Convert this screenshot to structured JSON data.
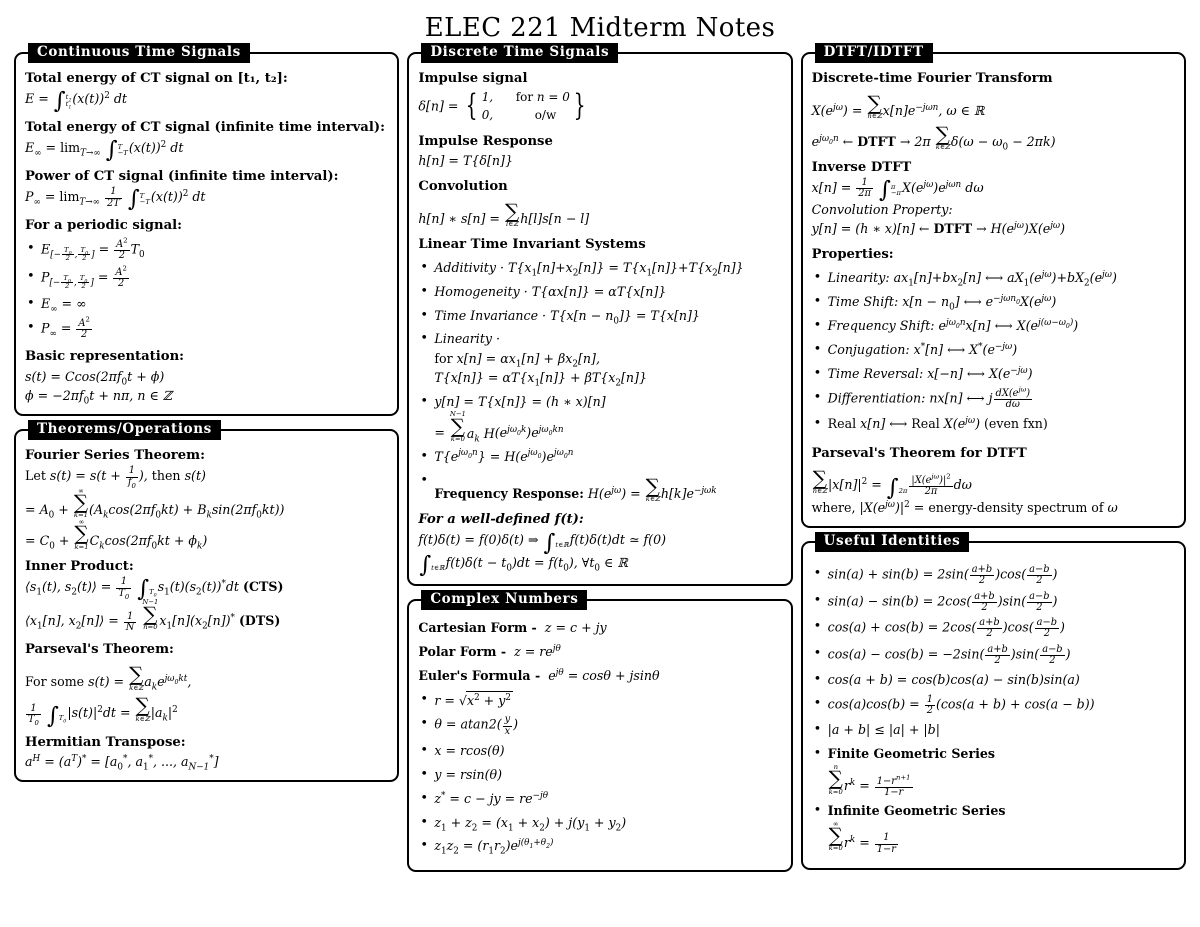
{
  "title": "ELEC 221 Midterm Notes",
  "boxes": {
    "ct": {
      "title": "Continuous Time Signals",
      "h_total_energy": "Total energy of CT signal on [t₁, t₂]:",
      "h_total_energy_inf": "Total energy of CT signal (infinite time interval):",
      "h_power_inf": "Power of CT signal (infinite time interval):",
      "h_periodic": "For a periodic signal:",
      "h_basic": "Basic representation:",
      "eq_energy": "E = ∫_{t₁}^{t₂} (x(t))² dt",
      "eq_energy_inf": "E∞ = lim_{T→∞} ∫_{-T}^{T} (x(t))² dt",
      "eq_power_inf": "P∞ = lim_{T→∞} (1/2T) ∫_{-T}^{T} (x(t))² dt",
      "bullets": [
        "E|-T₀/2, T₀/2| = (A²/2) T₀",
        "P|-T₀/2, T₀/2| = A²/2",
        "E∞ = ∞",
        "P∞ = A²/2"
      ],
      "eq_basic_1": "s(t) = C cos(2πf₀t + ϕ)",
      "eq_basic_2": "ϕ = -2πf₀t + nπ, n ∈ ℤ"
    },
    "theorems": {
      "title": "Theorems/Operations",
      "h_fourier": "Fourier Series Theorem:",
      "fs_line1": "Let s(t) = s(t + 1/f₀), then s(t)",
      "fs_line2": "= A₀ + ∑_{k=1}^{∞} (A_k cos(2πf₀kt) + B_k sin(2πf₀kt))",
      "fs_line3": "= C₀ + ∑_{k=1}^{∞} C_k cos(2πf₀kt + ϕ_k)",
      "h_inner": "Inner Product:",
      "ip_cts": "⟨s₁(t), s₂(t)⟩ = (1/T₀) ∫_{T₀} s₁(t)(s₂(t))* dt (CTS)",
      "ip_dts": "⟨x₁[n], x₂[n]⟩ = (1/N) ∑_{n=0}^{N-1} x₁[n](x₂[n])* (DTS)",
      "h_parseval": "Parseval's Theorem:",
      "pv_line1": "For some s(t) = ∑_{k∈ℤ} a_k e^{jω₀kt},",
      "pv_line2": "(1/T₀) ∫_{T₀} |s(t)|²dt = ∑_{k∈ℤ} |a_k|²",
      "h_hermitian": "Hermitian Transpose:",
      "herm": "a^H = (a^T)* = [a₀*, a₁*, ..., a_{N-1}*]"
    },
    "dt": {
      "title": "Discrete Time Signals",
      "h_impulse": "Impulse signal",
      "impulse_case1_val": "1,",
      "impulse_case1_cond": "for n = 0",
      "impulse_case2_val": "0,",
      "impulse_case2_cond": "o/w",
      "h_impulse_response": "Impulse Response",
      "eq_impulse_response": "h[n] = T{δ[n]}",
      "h_convolution": "Convolution",
      "eq_convolution": "h[n] * s[n] = ∑_{l∈ℤ} h[l]s[n - l]",
      "h_lti": "Linear Time Invariant Systems",
      "lti": [
        "Additivity · T{x₁[n]+x₂[n]} = T{x₁[n]}+T{x₂[n]}",
        "Homogeneity · T{αx[n]} = αT{x[n]}",
        "Time Invariance · T{x[n - n₀]} = T{x[n]}",
        "Linearity ·",
        "y[n] = T{x[n]} = (h * x)[n]",
        "T{e^{jω₀n}} = H(e^{jω₀})e^{jω₀n}",
        "Frequency Response: H(e^{jω}) = ∑_{k∈ℤ} h[k]e^{-jωk}"
      ],
      "lin_sub1": "for x[n] = αx₁[n] + βx₂[n],",
      "lin_sub2": "T{x[n]} = αT{x₁[n]} + βT{x₂[n]}",
      "y_sub": "= ∑_{k=0}^{N-1} a_k H(e^{jω₀k})e^{jω₀kn}",
      "h_welldefined": "For a well-defined f(t):",
      "wd_line1": "f(t)δ(t) = f(0)δ(t) ⇒ ∫_{t∈ℝ} f(t)δ(t)dt ≃ f(0)",
      "wd_line2": "∫_{t∈ℝ} f(t)δ(t - t₀)dt = f(t₀), ∀t₀ ∈ ℝ"
    },
    "complex": {
      "title": "Complex Numbers",
      "h_cartesian": "Cartesian Form -",
      "eq_cartesian": "z = c + jy",
      "h_polar": "Polar Form -",
      "eq_polar": "z = re^{jθ}",
      "h_euler": "Euler's Formula -",
      "eq_euler": "e^{jθ} = cosθ + jsinθ",
      "bullets": [
        "r = √(x² + y²)",
        "θ = atan2(y/x)",
        "x = rcos(θ)",
        "y = rsin(θ)",
        "z* = c - jy = re^{-jθ}",
        "z₁ + z₂ = (x₁ + x₂) + j(y₁ + y₂)",
        "z₁z₂ = (r₁r₂)e^{j(θ₁+θ₂)}"
      ]
    },
    "dtft": {
      "title": "DTFT/IDTFT",
      "h_dtft": "Discrete-time Fourier Transform",
      "dtft_line1": "X(e^{jω}) = ∑_{n∈ℤ} x[n]e^{-jωn}, ω ∈ ℝ",
      "dtft_line2": "e^{jω₀n} ← DTFT → 2π ∑_{k∈ℤ} δ(ω - ω₀ - 2πk)",
      "h_idtft": "Inverse DTFT",
      "idtft_line1": "x[n] = (1/2π) ∫_{-π}^{π} X(e^{jω})e^{jωn} dω",
      "h_convprop": "Convolution Property:",
      "convprop": "y[n] = (h * x)[n] ← DTFT → H(e^{jω})X(e^{jω})",
      "h_properties": "Properties:",
      "properties": [
        "Linearity: ax₁[n]+bx₂[n] ⟷ aX₁(e^{jω})+bX₂(e^{jω})",
        "Time Shift: x[n - n₀] ⟷ e^{-jωn₀}X(e^{jω})",
        "Frequency Shift: e^{jω₀n}x[n] ⟷ X(e^{j(ω-ω₀)})",
        "Conjugation: x*[n] ⟷ X*(e^{-jω})",
        "Time Reversal: x[-n] ⟷ X(e^{-jω})",
        "Differentiation: nx[n] ⟷ j dX(e^{jω})/dω",
        "Real x[n] ⟷ Real X(e^{jω}) (even fxn)"
      ],
      "h_parseval": "Parseval's Theorem for DTFT",
      "pv_line1": "∑_{n∈ℤ} |x[n]|² = ∫_{2π} |X(e^{jω})|²/2π dω",
      "pv_line2": "where, |X(e^{jω})|² = energy-density spectrum of ω"
    },
    "identities": {
      "title": "Useful Identities",
      "bullets": [
        "sin(a) + sin(b) = 2sin((a+b)/2)cos((a-b)/2)",
        "sin(a) - sin(b) = 2cos((a+b)/2)sin((a-b)/2)",
        "cos(a) + cos(b) = 2cos((a+b)/2)cos((a-b)/2)",
        "cos(a) - cos(b) = -2sin((a+b)/2)sin((a-b)/2)",
        "cos(a + b) = cos(b)cos(a) - sin(b)sin(a)",
        "cos(a)cos(b) = ½(cos(a + b) + cos(a - b))",
        "|a + b| ≤ |a| + |b|"
      ],
      "h_finite": "Finite Geometric Series",
      "eq_finite": "∑_{k=0}^{n} r^k = (1 - r^{n+1})/(1 - r)",
      "h_infinite": "Infinite Geometric Series",
      "eq_infinite": "∑_{k=0}^{∞} r^k = 1/(1 - r)"
    }
  }
}
